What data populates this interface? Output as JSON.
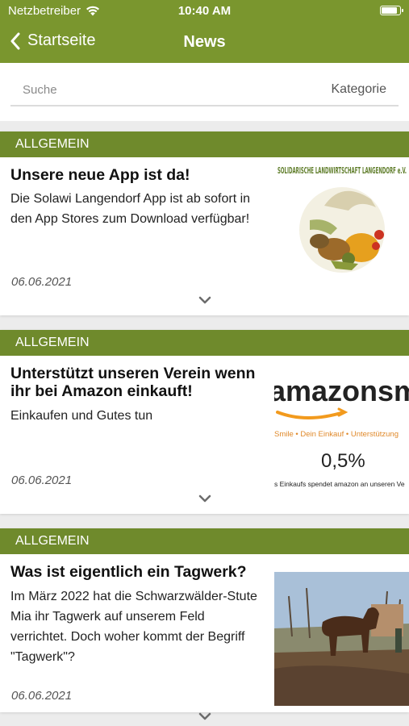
{
  "status_bar": {
    "carrier": "Netzbetreiber",
    "time": "10:40 AM"
  },
  "nav": {
    "back_label": "Startseite",
    "title": "News"
  },
  "filter": {
    "search_placeholder": "Suche",
    "category_label": "Kategorie"
  },
  "colors": {
    "header_green": "#7a962e",
    "category_green": "#6f8a2c"
  },
  "news": [
    {
      "category": "ALLGEMEIN",
      "title": "Unsere neue App ist da!",
      "text": "Die Solawi Langendorf App ist ab sofort in den App Stores zum Download verfügbar!",
      "date": "06.06.2021",
      "image": {
        "top_text": "SOLIDARISCHE LANDWIRTSCHAFT LANGENDORF e.V."
      }
    },
    {
      "category": "ALLGEMEIN",
      "title": "Unterstützt unseren Verein wenn ihr bei Amazon einkauft!",
      "text": "Einkaufen und Gutes tun",
      "date": "06.06.2021",
      "image": {
        "brand": "amazonsmi",
        "tagline": "Smile • Dein Einkauf • Unterstützung",
        "percent": "0,5%",
        "footer": "s Einkaufs spendet amazon an unseren Ve"
      }
    },
    {
      "category": "ALLGEMEIN",
      "title": "Was ist eigentlich ein Tagwerk?",
      "text": "Im März 2022 hat die Schwarzwälder-Stute Mia ihr Tagwerk auf unserem Feld verrichtet. Doch woher kommt der Begriff \"Tagwerk\"?",
      "date": "06.06.2021"
    }
  ]
}
